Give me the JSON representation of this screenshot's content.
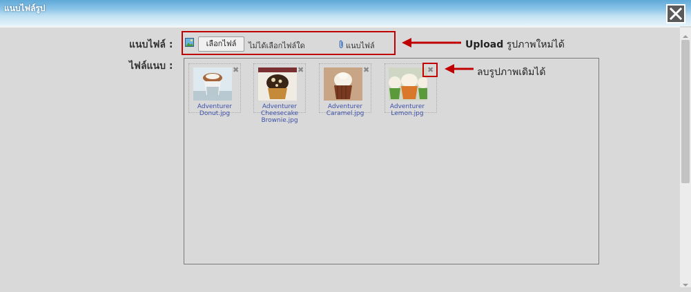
{
  "window": {
    "title": "แนบไฟล์รูป",
    "close_icon": "close-icon"
  },
  "form": {
    "attach_label": "แนบไฟล์ :",
    "files_label": "ไฟล์แนบ :",
    "choose_button": "เลือกไฟล์",
    "no_file_text": "ไม่ได้เลือกไฟล์ใด",
    "attach_link": "แนบไฟล์"
  },
  "files": [
    {
      "name": "Adventurer Donut.jpg",
      "lines": [
        "Adventurer",
        "Donut.jpg"
      ]
    },
    {
      "name": "Adventurer Cheesecake Brownie.jpg",
      "lines": [
        "Adventurer",
        "Cheesecake",
        "Brownie.jpg"
      ]
    },
    {
      "name": "Adventurer Caramel.jpg",
      "lines": [
        "Adventurer",
        "Caramel.jpg"
      ]
    },
    {
      "name": "Adventurer Lemon.jpg",
      "lines": [
        "Adventurer",
        "Lemon.jpg"
      ]
    }
  ],
  "annotations": {
    "upload_bold": "Upload",
    "upload_text": "รูปภาพใหม่ได้",
    "delete_text": "ลบรูปภาพเดิมได้"
  },
  "colors": {
    "accent_red": "#c00000",
    "link_blue": "#3a4ea8"
  }
}
